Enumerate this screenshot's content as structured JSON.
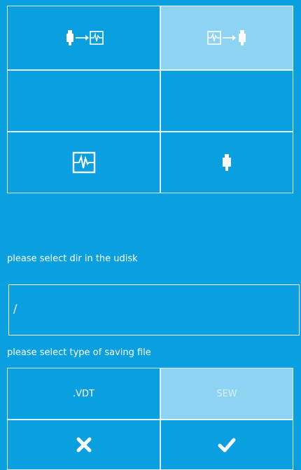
{
  "colors": {
    "background": "#0aa0df",
    "selected_tab": "#8fd3f2",
    "text": "#ffffff"
  },
  "tabs": [
    {
      "icon": "usb-to-device-icon",
      "selected": false
    },
    {
      "icon": "device-to-usb-icon",
      "selected": true
    }
  ],
  "sources": [
    {
      "icon": "device-memory-icon"
    },
    {
      "icon": "usb-drive-icon"
    }
  ],
  "dir_label": "please select dir in the udisk",
  "dir_value": "/",
  "type_label": "please select type of saving file",
  "file_types": [
    {
      "label": ".VDT",
      "selected": false
    },
    {
      "label": "SEW",
      "selected": true
    }
  ],
  "actions": {
    "cancel_icon": "close-icon",
    "confirm_icon": "check-icon"
  }
}
